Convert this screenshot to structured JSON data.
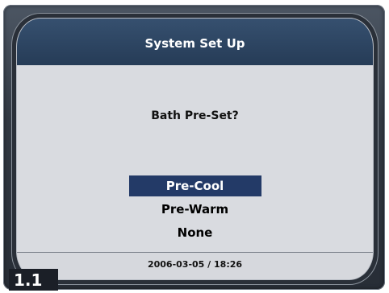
{
  "header": {
    "title": "System Set Up"
  },
  "main": {
    "question": "Bath Pre-Set?",
    "options": [
      {
        "label": "Pre-Cool",
        "selected": true
      },
      {
        "label": "Pre-Warm",
        "selected": false
      },
      {
        "label": "None",
        "selected": false
      }
    ]
  },
  "status": {
    "datetime": "2006-03-05 / 18:26"
  },
  "badge": {
    "label": "1.1"
  },
  "colors": {
    "title_bar": "#263c57",
    "selection": "#233a67",
    "screen_bg": "#d9dbe0"
  }
}
